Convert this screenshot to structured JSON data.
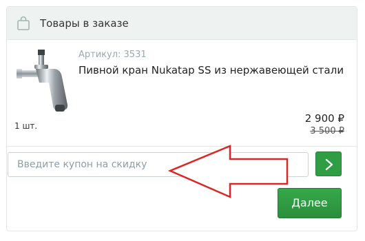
{
  "order": {
    "header": {
      "title": "Товары в заказе",
      "icon": "shopping-bag-icon"
    },
    "item": {
      "sku": "Артикул: 3531",
      "name": "Пивной кран Nukatap SS из нержавеющей стали",
      "quantity": "1 шт.",
      "price": "2 900 ₽",
      "old_price": "3 500 ₽"
    },
    "coupon": {
      "placeholder": "Введите купон на скидку",
      "value": "",
      "apply_icon": "chevron-right-icon"
    },
    "next_label": "Далее"
  },
  "colors": {
    "accent_green": "#2f9d43",
    "annotation_red": "#e02424",
    "header_bg": "#eef3f1"
  }
}
